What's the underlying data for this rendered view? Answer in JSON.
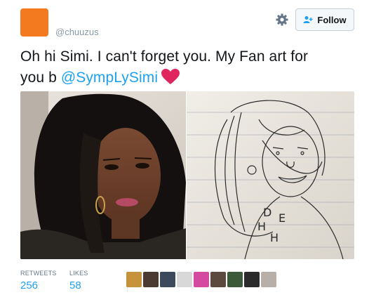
{
  "header": {
    "handle": "@chuuzus",
    "follow_label": "Follow",
    "avatar_color": "#f37a1f"
  },
  "tweet": {
    "text_line1": "Oh hi Simi. I can't forget you. My Fan art for",
    "text_before_mention": "you b ",
    "mention": "@SympLySimi",
    "heart_color": "#e0245e"
  },
  "media": {
    "left_photo": "selfie-photo",
    "right_photo": "pencil-sketch-photo",
    "sketch_letters": [
      "D",
      "E",
      "H",
      "H"
    ]
  },
  "stats": {
    "retweets_label": "RETWEETS",
    "retweets_value": "256",
    "likes_label": "LIKES",
    "likes_value": "58"
  },
  "likers": [
    "liker-1",
    "liker-2",
    "liker-3",
    "liker-4",
    "liker-5",
    "liker-6",
    "liker-7",
    "liker-8",
    "liker-9"
  ],
  "colors": {
    "link": "#1da1f2",
    "muted": "#8899a6"
  }
}
